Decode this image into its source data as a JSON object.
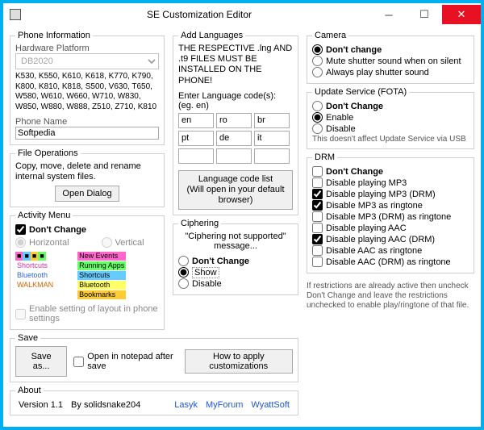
{
  "window": {
    "title": "SE Customization Editor"
  },
  "phone_info": {
    "legend": "Phone Information",
    "platform_label": "Hardware Platform",
    "platform_value": "DB2020",
    "models": "K530, K550, K610, K618, K770, K790, K800, K810, K818, S500, V630, T650, W580, W610, W660, W710, W830, W850, W880, W888, Z510, Z710, K810",
    "name_label": "Phone Name",
    "name_value": "Softpedia"
  },
  "file_ops": {
    "legend": "File Operations",
    "desc": "Copy, move, delete and rename internal system files.",
    "open": "Open Dialog"
  },
  "activity": {
    "legend": "Activity Menu",
    "dont_change": "Don't Change",
    "horizontal": "Horizontal",
    "vertical": "Vertical",
    "preview_h": [
      "Shortcuts",
      "Bluetooth",
      "WALKMAN"
    ],
    "preview_v": [
      "New Events",
      "Running Apps",
      "Shortcuts",
      "Bluetooth",
      "Bookmarks"
    ],
    "enable_setting": "Enable setting of layout in phone settings"
  },
  "save": {
    "legend": "Save",
    "save_as": "Save as...",
    "open_notepad": "Open in notepad after save",
    "how_to": "How to apply customizations"
  },
  "about": {
    "legend": "About",
    "version": "Version 1.1",
    "by": "By solidsnake204",
    "links": [
      "Lasyk",
      "MyForum",
      "WyattSoft"
    ]
  },
  "languages": {
    "legend": "Add Languages",
    "note": "THE RESPECTIVE .lng AND .t9 FILES MUST BE INSTALLED ON THE PHONE!",
    "enter": "Enter Language code(s): (eg. en)",
    "codes": [
      "en",
      "ro",
      "br",
      "pt",
      "de",
      "it",
      "",
      "",
      ""
    ],
    "list_btn": "Language code list\n(Will open in your default browser)"
  },
  "cipher": {
    "legend": "Ciphering",
    "desc": "\"Ciphering not supported\" message...",
    "dont": "Don't Change",
    "show": "Show",
    "disable": "Disable"
  },
  "camera": {
    "legend": "Camera",
    "dont": "Don't change",
    "mute": "Mute shutter sound when on silent",
    "always": "Always play shutter sound"
  },
  "fota": {
    "legend": "Update Service (FOTA)",
    "dont": "Don't Change",
    "enable": "Enable",
    "disable": "Disable",
    "note": "This doesn't affect Update Service via USB"
  },
  "drm": {
    "legend": "DRM",
    "dont": "Don't Change",
    "opts": [
      {
        "label": "Disable playing MP3",
        "checked": false
      },
      {
        "label": "Disable playing MP3 (DRM)",
        "checked": true
      },
      {
        "label": "Disable MP3 as ringtone",
        "checked": true
      },
      {
        "label": "Disable MP3 (DRM) as ringtone",
        "checked": false
      },
      {
        "label": "Disable playing AAC",
        "checked": false
      },
      {
        "label": "Disable playing AAC (DRM)",
        "checked": true
      },
      {
        "label": "Disable AAC as ringtone",
        "checked": false
      },
      {
        "label": "Disable AAC (DRM) as ringtone",
        "checked": false
      }
    ]
  },
  "footer_note": "If restrictions are already active then uncheck Don't Change and leave the restrictions unchecked to enable play/ringtone of that file."
}
